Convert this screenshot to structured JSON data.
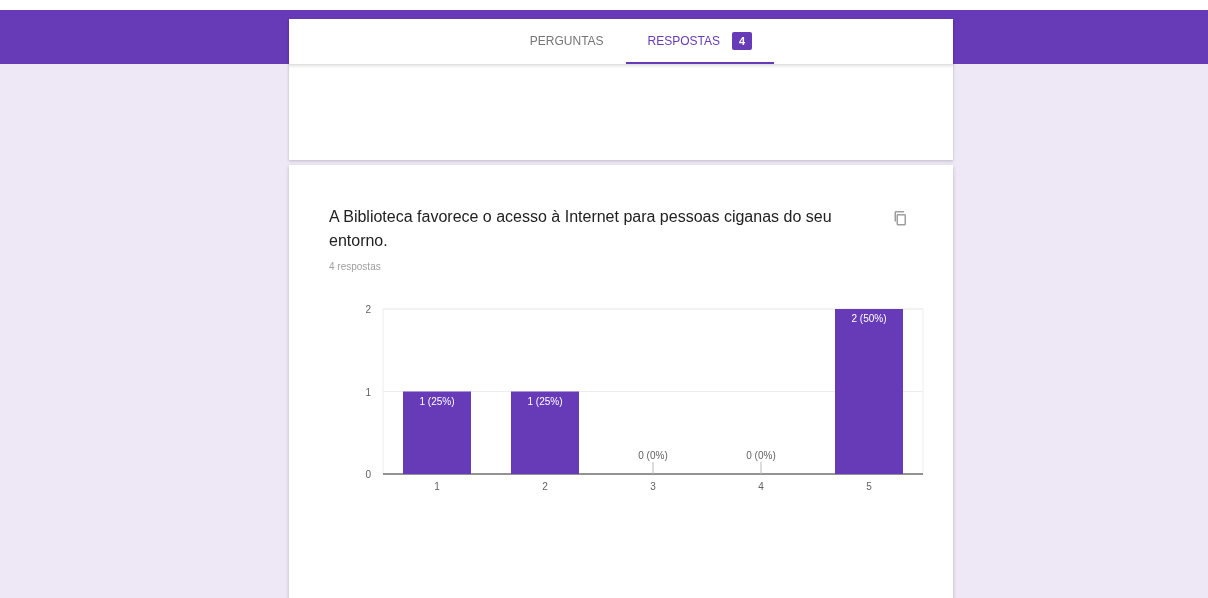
{
  "tabs": [
    {
      "label": "PERGUNTAS",
      "selected": false
    },
    {
      "label": "RESPOSTAS",
      "selected": true,
      "badge": "4"
    }
  ],
  "question": {
    "title": "A Biblioteca favorece o acesso à Internet para pessoas ciganas do seu entorno.",
    "count": "4 respostas",
    "chart_data": {
      "type": "bar",
      "categories": [
        "1",
        "2",
        "3",
        "4",
        "5"
      ],
      "series": [
        {
          "color": "#673ab7",
          "values": [
            1,
            1,
            0,
            0,
            2
          ]
        }
      ],
      "ylim": [
        0,
        2
      ],
      "yticks": [
        0,
        1,
        2
      ],
      "value_labels": [
        "1 (25%)",
        "1 (25%)",
        "0 (0%)",
        "0 (0%)",
        "2 (50%)"
      ]
    }
  }
}
